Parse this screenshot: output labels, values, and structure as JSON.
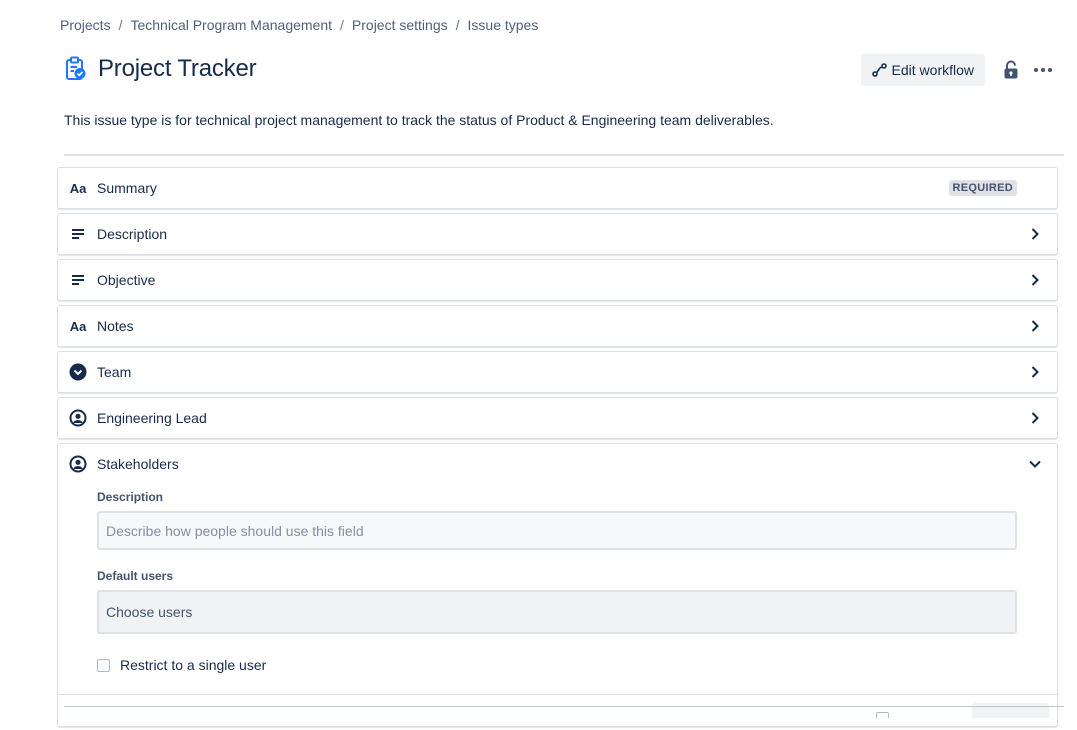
{
  "breadcrumb": {
    "items": [
      "Projects",
      "Technical Program Management",
      "Project settings",
      "Issue types"
    ],
    "separator": "/"
  },
  "header": {
    "title": "Project Tracker",
    "icon": "issue-type-clipboard-check-icon",
    "edit_workflow_label": "Edit workflow",
    "lock_icon": "unlock-icon",
    "more_icon": "more-horizontal-icon"
  },
  "description": "This issue type is for technical project management to track the status of Product & Engineering team deliverables.",
  "fields": [
    {
      "label": "Summary",
      "icon": "Aa",
      "required_badge": "REQUIRED"
    },
    {
      "label": "Description",
      "icon": "paragraph-icon"
    },
    {
      "label": "Objective",
      "icon": "paragraph-icon"
    },
    {
      "label": "Notes",
      "icon": "Aa"
    },
    {
      "label": "Team",
      "icon": "select-dropdown-icon"
    },
    {
      "label": "Engineering Lead",
      "icon": "user-picker-icon"
    },
    {
      "label": "Stakeholders",
      "icon": "user-picker-icon",
      "expanded": true
    }
  ],
  "stakeholders_config": {
    "description_label": "Description",
    "description_placeholder": "Describe how people should use this field",
    "default_users_label": "Default users",
    "default_users_placeholder": "Choose users",
    "restrict_label": "Restrict to a single user"
  },
  "colors": {
    "text": "#172b4d",
    "subtle_text": "#505f79",
    "border": "#dcdfe4",
    "button_bg": "#f1f2f4",
    "badge_bg": "#dfe1e6"
  }
}
